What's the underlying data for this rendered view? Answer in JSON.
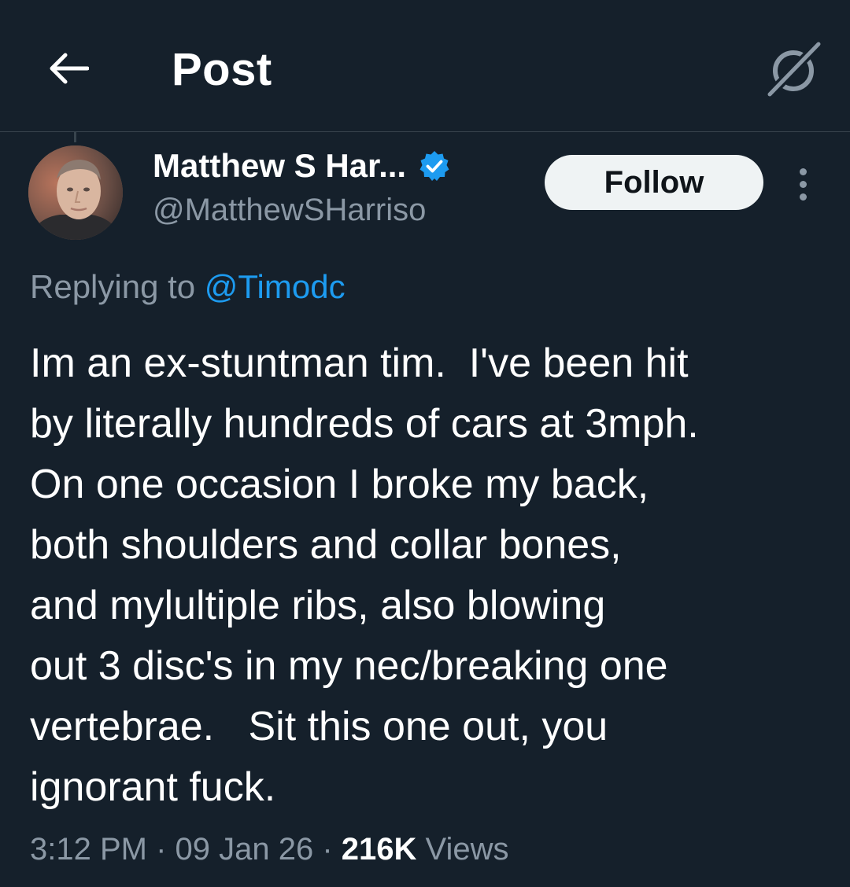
{
  "header": {
    "title": "Post",
    "back_icon": "back-arrow-icon",
    "grok_icon": "grok-icon"
  },
  "author": {
    "display_name": "Matthew S Har...",
    "handle": "@MatthewSHarriso",
    "verified": true,
    "verified_color": "#1d9bf0"
  },
  "actions": {
    "follow_label": "Follow",
    "more_icon": "more-vertical-icon"
  },
  "reply": {
    "prefix": "Replying to ",
    "handle": "@Timodc"
  },
  "tweet": {
    "lines": [
      "Im an ex-stuntman tim.  I've been hit",
      "by literally hundreds of cars at 3mph.",
      "On one occasion I broke my back,",
      "both shoulders and collar bones,",
      "and mylultiple ribs, also blowing",
      "out 3 disc's in my nec/breaking one",
      "vertebrae.   Sit this one out, you",
      "ignorant fuck."
    ]
  },
  "meta": {
    "time": "3:12 PM",
    "separator": " · ",
    "date": "09 Jan 26",
    "views_count": "216K",
    "views_label": " Views"
  },
  "colors": {
    "background": "#15202b",
    "accent": "#1d9bf0",
    "secondary_text": "#8b98a5",
    "divider": "#38444d"
  }
}
